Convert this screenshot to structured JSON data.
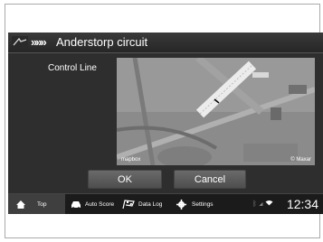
{
  "header": {
    "title": "Anderstorp circuit",
    "chevrons": "»»»"
  },
  "main": {
    "label": "Control Line",
    "map_attribution_left": "mapbox",
    "map_attribution_right": "© Maxar"
  },
  "dialog": {
    "ok_label": "OK",
    "cancel_label": "Cancel"
  },
  "nav": {
    "items": [
      {
        "label": "Top",
        "icon": "home-icon"
      },
      {
        "label": "Auto Score",
        "icon": "car-icon"
      },
      {
        "label": "Data Log",
        "icon": "flag-icon"
      },
      {
        "label": "Settings",
        "icon": "gear-icon"
      }
    ],
    "time": "12:34"
  }
}
